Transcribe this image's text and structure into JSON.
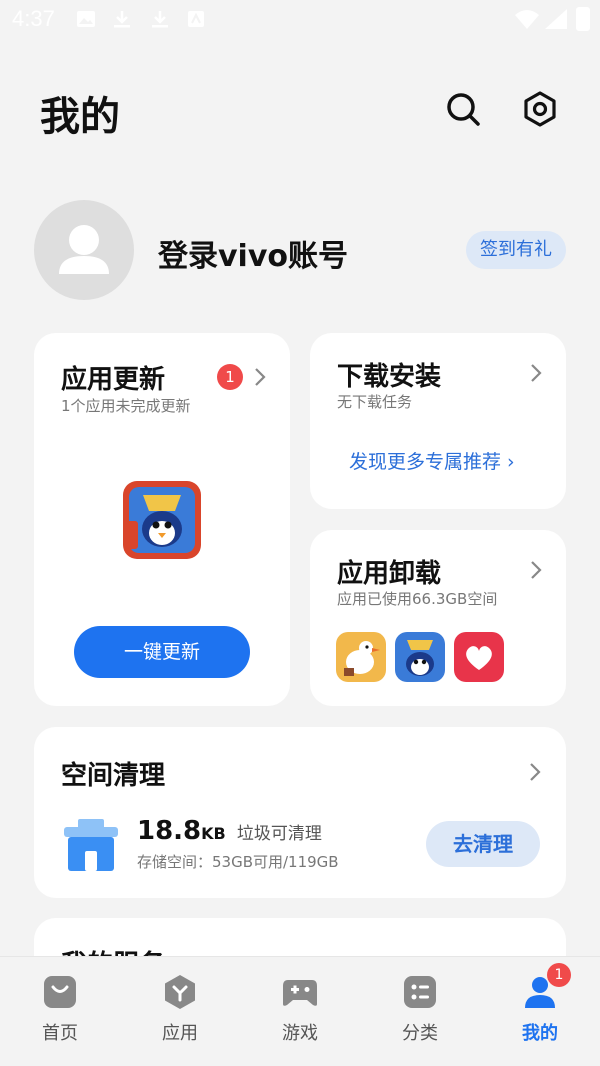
{
  "status_bar": {
    "time": "4:37"
  },
  "header": {
    "title": "我的"
  },
  "profile": {
    "login_text": "登录vivo账号",
    "checkin_label": "签到有礼"
  },
  "app_update": {
    "title": "应用更新",
    "badge": "1",
    "subtitle": "1个应用未完成更新",
    "button_label": "一键更新"
  },
  "download": {
    "title": "下载安装",
    "subtitle": "无下载任务",
    "link": "发现更多专属推荐 ›"
  },
  "uninstall": {
    "title": "应用卸载",
    "subtitle": "应用已使用66.3GB空间"
  },
  "cleanup": {
    "title": "空间清理",
    "size_value": "18.8",
    "size_unit": "KB",
    "size_desc": "垃圾可清理",
    "storage": "存储空间：53GB可用/119GB",
    "button_label": "去清理"
  },
  "services": {
    "title": "我的服务"
  },
  "nav": {
    "items": [
      {
        "label": "首页"
      },
      {
        "label": "应用"
      },
      {
        "label": "游戏"
      },
      {
        "label": "分类"
      },
      {
        "label": "我的"
      }
    ],
    "mine_badge": "1"
  },
  "colors": {
    "accent": "#1e73f0",
    "badge": "#f04a4a",
    "background": "#f3f3f3"
  }
}
